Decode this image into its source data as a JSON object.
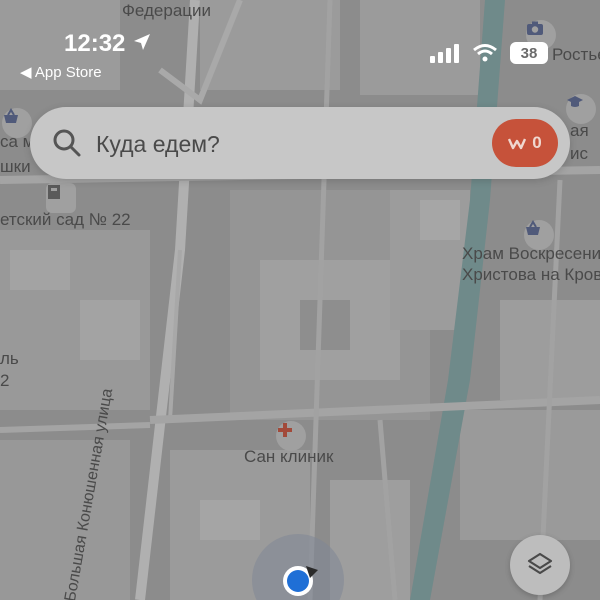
{
  "status_bar": {
    "time": "12:32",
    "back_app": "◀ App Store",
    "battery": "38"
  },
  "search": {
    "placeholder": "Куда едем?"
  },
  "promo_badge": {
    "value": "0"
  },
  "map_labels": {
    "federation": "Федерации",
    "street": "Большая Конюшенная улица",
    "clinic": "Сан клиник",
    "temple_line1": "Храм Воскресения",
    "temple_line2": "Христова на Кров",
    "kindergarten": "етский сад № 22",
    "top_right": "Ростье",
    "left_fragment1": "са м",
    "left_fragment2": "шки",
    "left_fragment3": "ль",
    "left_fragment4": "2",
    "right_fragment1": "ая",
    "right_fragment2": "ис"
  },
  "colors": {
    "map_bg": "#8c8c8c",
    "building": "#9d9d9d",
    "road": "#b0b0b0",
    "canal": "#6f8a8a",
    "promo": "#c6523a",
    "location": "#1f6fd6"
  },
  "icons": {
    "location_arrow": "location-arrow-icon",
    "signal": "signal-icon",
    "wifi": "wifi-icon",
    "search": "search-icon",
    "promo": "promo-icon",
    "layers": "layers-icon",
    "clinic": "cross-icon",
    "basket": "basket-icon",
    "camera": "camera-icon"
  }
}
